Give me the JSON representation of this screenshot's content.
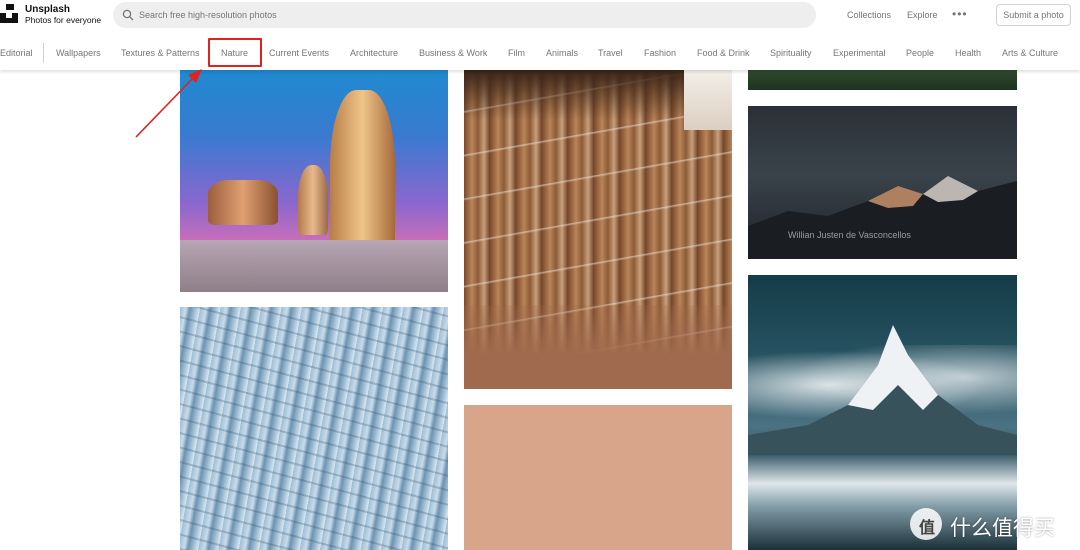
{
  "header": {
    "brand": "Unsplash",
    "tagline": "Photos for everyone",
    "search_placeholder": "Search free high-resolution photos",
    "nav": [
      "Collections",
      "Explore"
    ],
    "more_label": "•••",
    "submit_label": "Submit a photo"
  },
  "categories": {
    "items": [
      "Editorial",
      "Wallpapers",
      "Textures & Patterns",
      "Nature",
      "Current Events",
      "Architecture",
      "Business & Work",
      "Film",
      "Animals",
      "Travel",
      "Fashion",
      "Food & Drink",
      "Spirituality",
      "Experimental",
      "People",
      "Health",
      "Arts & Culture"
    ],
    "highlighted": "Nature"
  },
  "photos": {
    "credit": "Willian Justen de Vasconcellos"
  },
  "watermark": {
    "badge": "值",
    "text": "什么值得买"
  },
  "colors": {
    "annotation": "#e4221c",
    "nav_text": "#767676"
  }
}
